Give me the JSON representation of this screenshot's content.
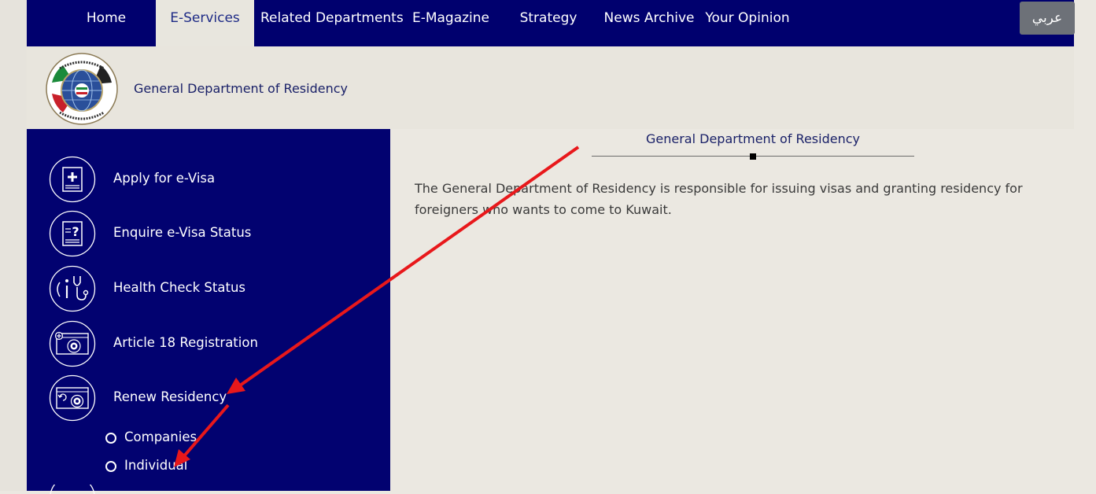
{
  "nav": {
    "items": [
      {
        "label": "Home"
      },
      {
        "label": "E-Services"
      },
      {
        "label": "Related Departments"
      },
      {
        "label": "E-Magazine"
      },
      {
        "label": "Strategy"
      },
      {
        "label": "News Archive"
      },
      {
        "label": "Your Opinion"
      }
    ],
    "active": "E-Services",
    "language_button": "عربي"
  },
  "header": {
    "title": "General Department of Residency",
    "logo_icon": "residency-emblem"
  },
  "sidebar": {
    "items": [
      {
        "label": "Apply for e-Visa",
        "icon": "visa-plus-icon"
      },
      {
        "label": "Enquire e-Visa Status",
        "icon": "visa-question-icon"
      },
      {
        "label": "Health Check Status",
        "icon": "stethoscope-icon"
      },
      {
        "label": "Article 18 Registration",
        "icon": "registration-card-icon"
      },
      {
        "label": "Renew Residency",
        "icon": "renew-card-icon"
      }
    ],
    "subitems": [
      {
        "label": "Companies"
      },
      {
        "label": "Individual"
      }
    ]
  },
  "content": {
    "title": "General Department of Residency",
    "text": "The General Department of Residency is responsible for issuing visas and granting residency for foreigners who wants to come to Kuwait."
  },
  "colors": {
    "nav_bg": "#00006e",
    "sidebar_bg": "#020270",
    "page_bg": "#ebe8e1",
    "accent_title": "#1a2168",
    "annotation_arrow": "#e8181b"
  }
}
